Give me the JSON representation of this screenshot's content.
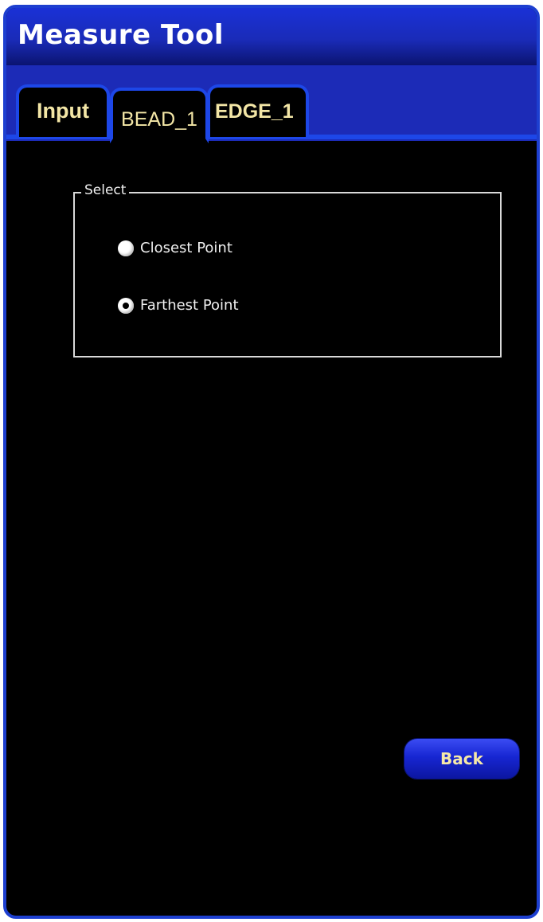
{
  "window": {
    "title": "Measure Tool"
  },
  "tabs": [
    {
      "label": "Input",
      "active": false
    },
    {
      "label": "BEAD_1",
      "active": true
    },
    {
      "label": "EDGE_1",
      "active": false
    }
  ],
  "select_group": {
    "legend": "Select",
    "options": [
      {
        "label": "Closest Point",
        "selected": false
      },
      {
        "label": "Farthest Point",
        "selected": true
      }
    ]
  },
  "actions": {
    "back_label": "Back"
  },
  "colors": {
    "accent_blue": "#1d47e8",
    "tab_text": "#f3e6a6",
    "background": "#000000"
  }
}
